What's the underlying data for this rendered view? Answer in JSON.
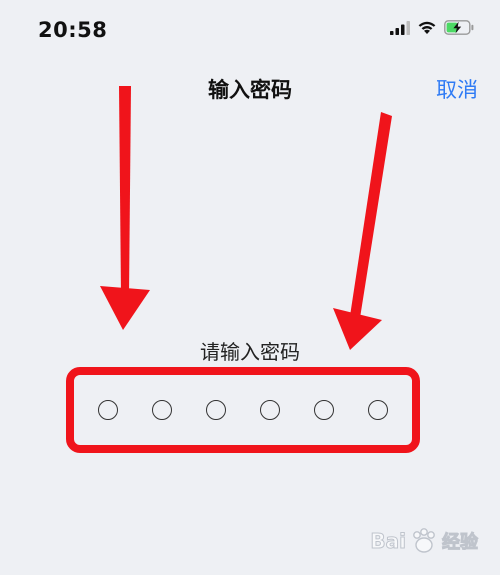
{
  "status_bar": {
    "time": "20:58",
    "icons": [
      "cellular-signal-icon",
      "wifi-icon",
      "battery-charging-icon"
    ]
  },
  "nav": {
    "title": "输入密码",
    "cancel_label": "取消"
  },
  "passcode": {
    "prompt": "请输入密码",
    "digits_total": 6,
    "digits_entered": 0
  },
  "colors": {
    "background": "#eef0f4",
    "accent_blue": "#2f7bf5",
    "annotation_red": "#f0141b",
    "battery_green": "#4cd964"
  },
  "watermark": {
    "logo_text": "Bai",
    "logo_suffix": "经验",
    "icon": "baidu-paw-icon"
  }
}
